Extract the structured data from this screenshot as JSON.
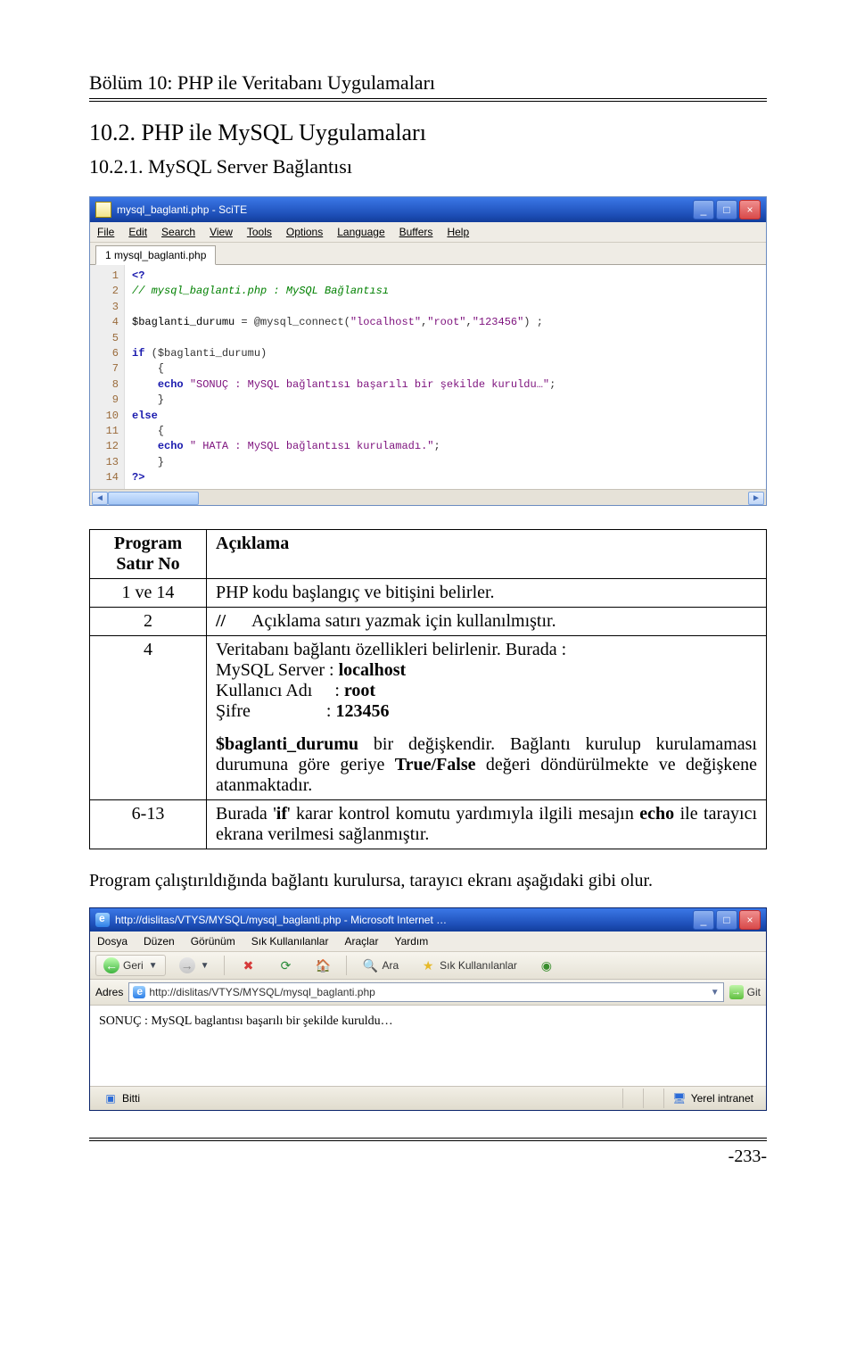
{
  "header": "Bölüm 10: PHP ile Veritabanı Uygulamaları",
  "h1": "10.2. PHP ile MySQL Uygulamaları",
  "h2": "10.2.1. MySQL Server Bağlantısı",
  "scite": {
    "title": "mysql_baglanti.php - SciTE",
    "menu": [
      "File",
      "Edit",
      "Search",
      "View",
      "Tools",
      "Options",
      "Language",
      "Buffers",
      "Help"
    ],
    "tab": "1 mysql_baglanti.php",
    "gutter": [
      "1",
      "2",
      "3",
      "4",
      "5",
      "6",
      "7",
      "8",
      "9",
      "10",
      "11",
      "12",
      "13",
      "14"
    ],
    "code": {
      "l1a": "<?",
      "l2a": "// mysql_baglanti.php : MySQL Bağlantısı",
      "l4a": "$baglanti_durumu",
      "l4b": " = @mysql_connect(",
      "l4c": "\"localhost\"",
      "l4d": ",",
      "l4e": "\"root\"",
      "l4f": ",",
      "l4g": "\"123456\"",
      "l4h": ") ;",
      "l6a": "if",
      "l6b": " (",
      "l6c": "$baglanti_durumu",
      "l6d": ")",
      "l7a": "    {",
      "l8a": "    ",
      "l8b": "echo",
      "l8c": " ",
      "l8d": "\"SONUÇ : MySQL bağlantısı başarılı bir şekilde kuruldu…\"",
      "l8e": ";",
      "l9a": "    }",
      "l10a": "else",
      "l11a": "    {",
      "l12a": "    ",
      "l12b": "echo",
      "l12c": " ",
      "l12d": "\" HATA : MySQL bağlantısı kurulamadı.\"",
      "l12e": ";",
      "l13a": "    }",
      "l14a": "?>"
    }
  },
  "table": {
    "col1": "Program\nSatır No",
    "col2": "Açıklama",
    "r1c1": "1 ve 14",
    "r1c2": "PHP kodu başlangıç ve bitişini belirler.",
    "r2c1": "2",
    "r2c2_a": "//",
    "r2c2_b": "      Açıklama satırı yazmak için kullanılmıştır.",
    "r3c1": "4",
    "r3_line1": "Veritabanı bağlantı özellikleri belirlenir. Burada :",
    "r3_l2a": "MySQL Server",
    "r3_l2b": " : ",
    "r3_l2c": "localhost",
    "r3_l3a": "Kullanıcı Adı",
    "r3_l3b": "     : ",
    "r3_l3c": "root",
    "r3_l4a": "Şifre",
    "r3_l4b": "                 : ",
    "r3_l4c": "123456",
    "r3_p_a": "$baglanti_durumu",
    "r3_p_b": " bir değişkendir. Bağlantı kurulup kurulamaması durumuna göre geriye ",
    "r3_p_c": "True/False",
    "r3_p_d": " değeri döndürülmekte ve değişkene atanmaktadır.",
    "r4c1": "6-13",
    "r4_a": "Burada '",
    "r4_b": "if",
    "r4_c": "' karar kontrol komutu yardımıyla ilgili mesajın ",
    "r4_d": "echo",
    "r4_e": " ile tarayıcı ekrana verilmesi sağlanmıştır."
  },
  "para1": "Program çalıştırıldığında bağlantı kurulursa, tarayıcı ekranı aşağıdaki gibi olur.",
  "ie": {
    "title": "http://dislitas/VTYS/MYSQL/mysql_baglanti.php - Microsoft Internet …",
    "menu": [
      "Dosya",
      "Düzen",
      "Görünüm",
      "Sık Kullanılanlar",
      "Araçlar",
      "Yardım"
    ],
    "back": "Geri",
    "search": "Ara",
    "fav": "Sık Kullanılanlar",
    "addrLabel": "Adres",
    "url": "http://dislitas/VTYS/MYSQL/mysql_baglanti.php",
    "go": "Git",
    "content": "SONUÇ : MySQL baglantısı başarılı bir şekilde kuruldu…",
    "status": "Bitti",
    "zone": "Yerel intranet"
  },
  "pageNum": "-233-"
}
